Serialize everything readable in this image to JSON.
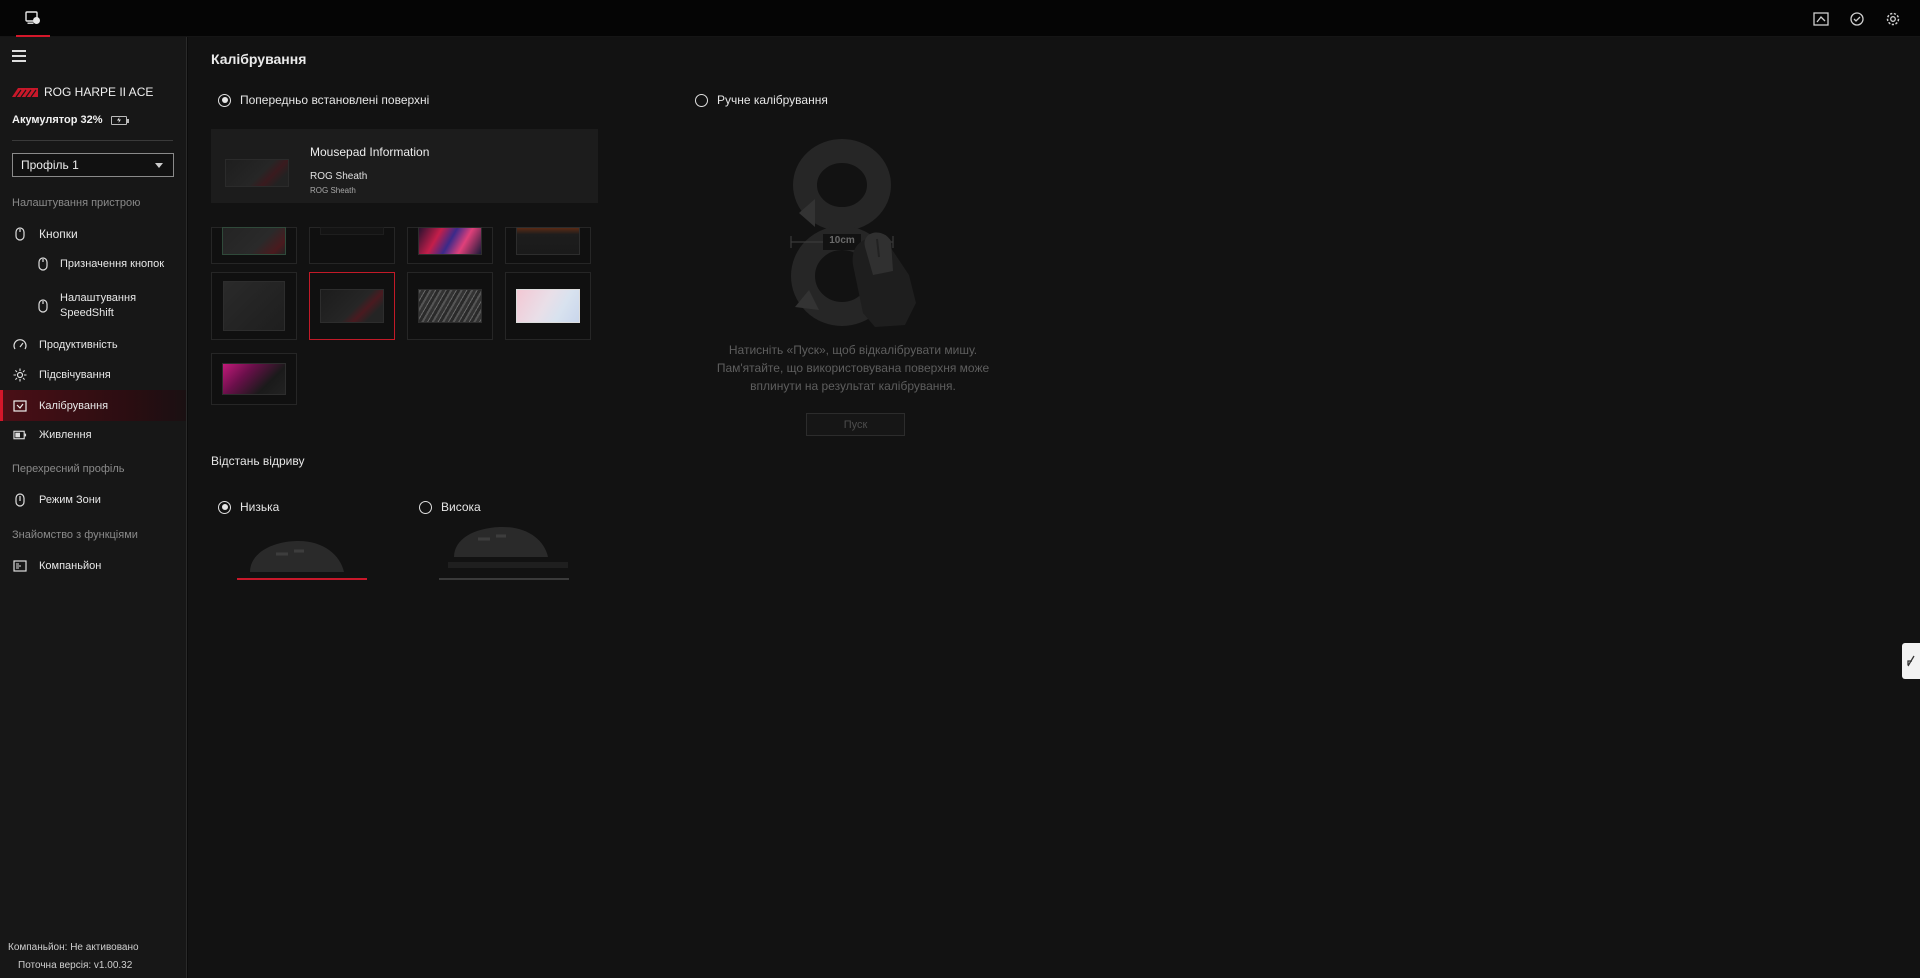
{
  "device": {
    "name": "ROG HARPE II ACE",
    "battery_label": "Акумулятор 32%"
  },
  "profile": {
    "selected": "Профіль 1"
  },
  "sidebar": {
    "section_device": "Налаштування пристрою",
    "items": {
      "buttons": "Кнопки",
      "button_assignment": "Призначення кнопок",
      "speedshift_line1": "Налаштування",
      "speedshift_line2": "SpeedShift",
      "performance": "Продуктивність",
      "lighting": "Підсвічування",
      "calibration": "Калібрування",
      "power": "Живлення"
    },
    "section_cross": "Перехресний профіль",
    "zone_mode": "Режим Зони",
    "section_features": "Знайомство з функціями",
    "companion": "Компаньйон",
    "footer_companion": "Компаньйон: Не активовано",
    "footer_version": "Поточна версія: v1.00.32"
  },
  "main": {
    "title": "Калібрування",
    "preset_label": "Попередньо встановлені поверхні",
    "manual_label": "Ручне калібрування",
    "info_card": {
      "title": "Mousepad Information",
      "name": "ROG Sheath",
      "sub": "ROG Sheath"
    },
    "lift": {
      "title": "Відстань відриву",
      "low": "Низька",
      "high": "Висока"
    },
    "manual": {
      "distance": "10cm",
      "instructions": [
        "Натисніть «Пуск», щоб відкалібрувати мишу.",
        "Пам'ятайте, що використовувана поверхня може",
        "вплинути на результат калібрування."
      ],
      "start_label": "Пуск"
    }
  },
  "colors": {
    "accent": "#d3172a",
    "background": "#121212",
    "sidebar": "#171717"
  },
  "icons": {
    "app": "mouse-app-icon",
    "top": [
      "screenshot-icon",
      "sync-icon",
      "gear-icon"
    ]
  }
}
